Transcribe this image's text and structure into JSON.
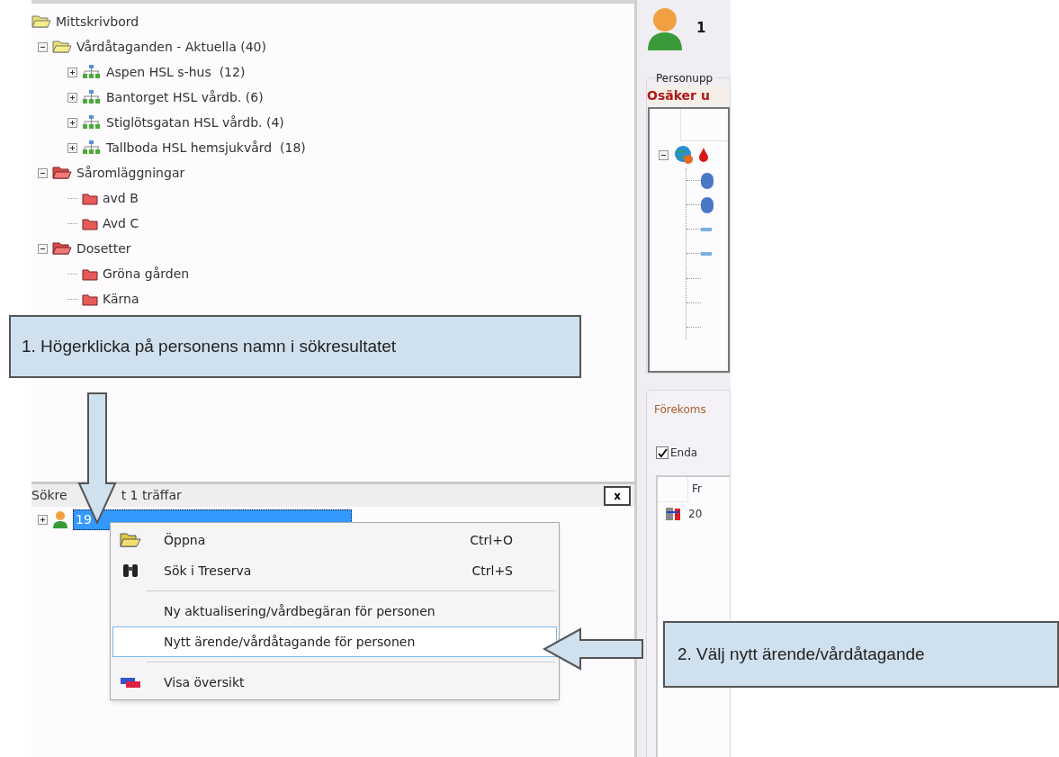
{
  "tree": [
    {
      "label": "Mittskrivbord",
      "kind": "desk",
      "children": [
        {
          "label": "Vårdåtaganden - Aktuella (40)",
          "kind": "folder",
          "expanded": true,
          "children": [
            {
              "label": "Aspen HSL s-hus  (12)",
              "kind": "unit",
              "expanded": false
            },
            {
              "label": "Bantorget HSL vårdb. (6)",
              "kind": "unit",
              "expanded": false
            },
            {
              "label": "Stiglötsgatan HSL vårdb. (4)",
              "kind": "unit",
              "expanded": false
            },
            {
              "label": "Tallboda HSL hemsjukvård  (18)",
              "kind": "unit",
              "expanded": false
            }
          ]
        },
        {
          "label": "Såromläggningar",
          "kind": "casefolder",
          "expanded": true,
          "children": [
            {
              "label": "avd B",
              "kind": "case"
            },
            {
              "label": "Avd C",
              "kind": "case"
            }
          ]
        },
        {
          "label": "Dosetter",
          "kind": "casefolder",
          "expanded": true,
          "children": [
            {
              "label": "Gröna gården",
              "kind": "case"
            },
            {
              "label": "Kärna",
              "kind": "case"
            }
          ]
        }
      ]
    }
  ],
  "search_panel": {
    "title_parts": [
      "Sökre",
      "t 1 träffar"
    ],
    "close": "x",
    "result": {
      "label": "19",
      "expanded": false,
      "selected": true
    }
  },
  "context_menu": [
    {
      "kind": "open",
      "label": "Öppna",
      "shortcut": "Ctrl+O",
      "selected": false
    },
    {
      "kind": "find",
      "label": "Sök i Treserva",
      "shortcut": "Ctrl+S",
      "selected": false
    },
    {
      "kind": "separator"
    },
    {
      "kind": "plain",
      "label": "Ny aktualisering/vårdbegäran för personen",
      "selected": false
    },
    {
      "kind": "plain",
      "label": "Nytt ärende/vårdåtagande för personen",
      "selected": true
    },
    {
      "kind": "separator"
    },
    {
      "kind": "overview",
      "label": "Visa översikt",
      "selected": false
    }
  ],
  "person_panel": {
    "heading": "1",
    "group_label": "Personupp",
    "warning": "Osäker u",
    "grid_expanded": true
  },
  "occurrence_panel": {
    "group_label": "Förekoms",
    "checkbox": {
      "label": "Enda",
      "checked": true
    },
    "column": "Fr",
    "cell": "20"
  },
  "callouts": [
    "1. Högerklicka på personens namn i sökresultatet",
    "2. Välj nytt ärende/vårdåtagande"
  ]
}
